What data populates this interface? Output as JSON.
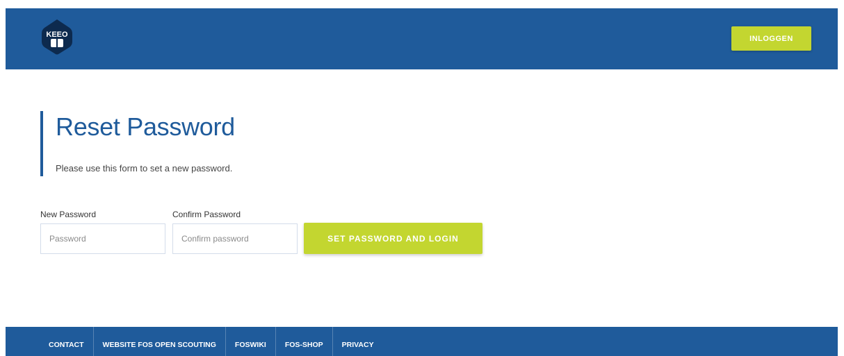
{
  "header": {
    "logo_text": "KEEO",
    "login_label": "INLOGGEN",
    "bg_color": "#1f5b9b",
    "accent_color": "#c3d630"
  },
  "main": {
    "title": "Reset Password",
    "subtitle": "Please use this form to set a new password.",
    "form": {
      "new_password_label": "New Password",
      "new_password_placeholder": "Password",
      "confirm_password_label": "Confirm Password",
      "confirm_password_placeholder": "Confirm password",
      "submit_label": "SET PASSWORD AND LOGIN"
    }
  },
  "footer": {
    "links": [
      {
        "label": "CONTACT"
      },
      {
        "label": "WEBSITE FOS OPEN SCOUTING"
      },
      {
        "label": "FOSWIKI"
      },
      {
        "label": "FOS-SHOP"
      },
      {
        "label": "PRIVACY"
      }
    ]
  }
}
